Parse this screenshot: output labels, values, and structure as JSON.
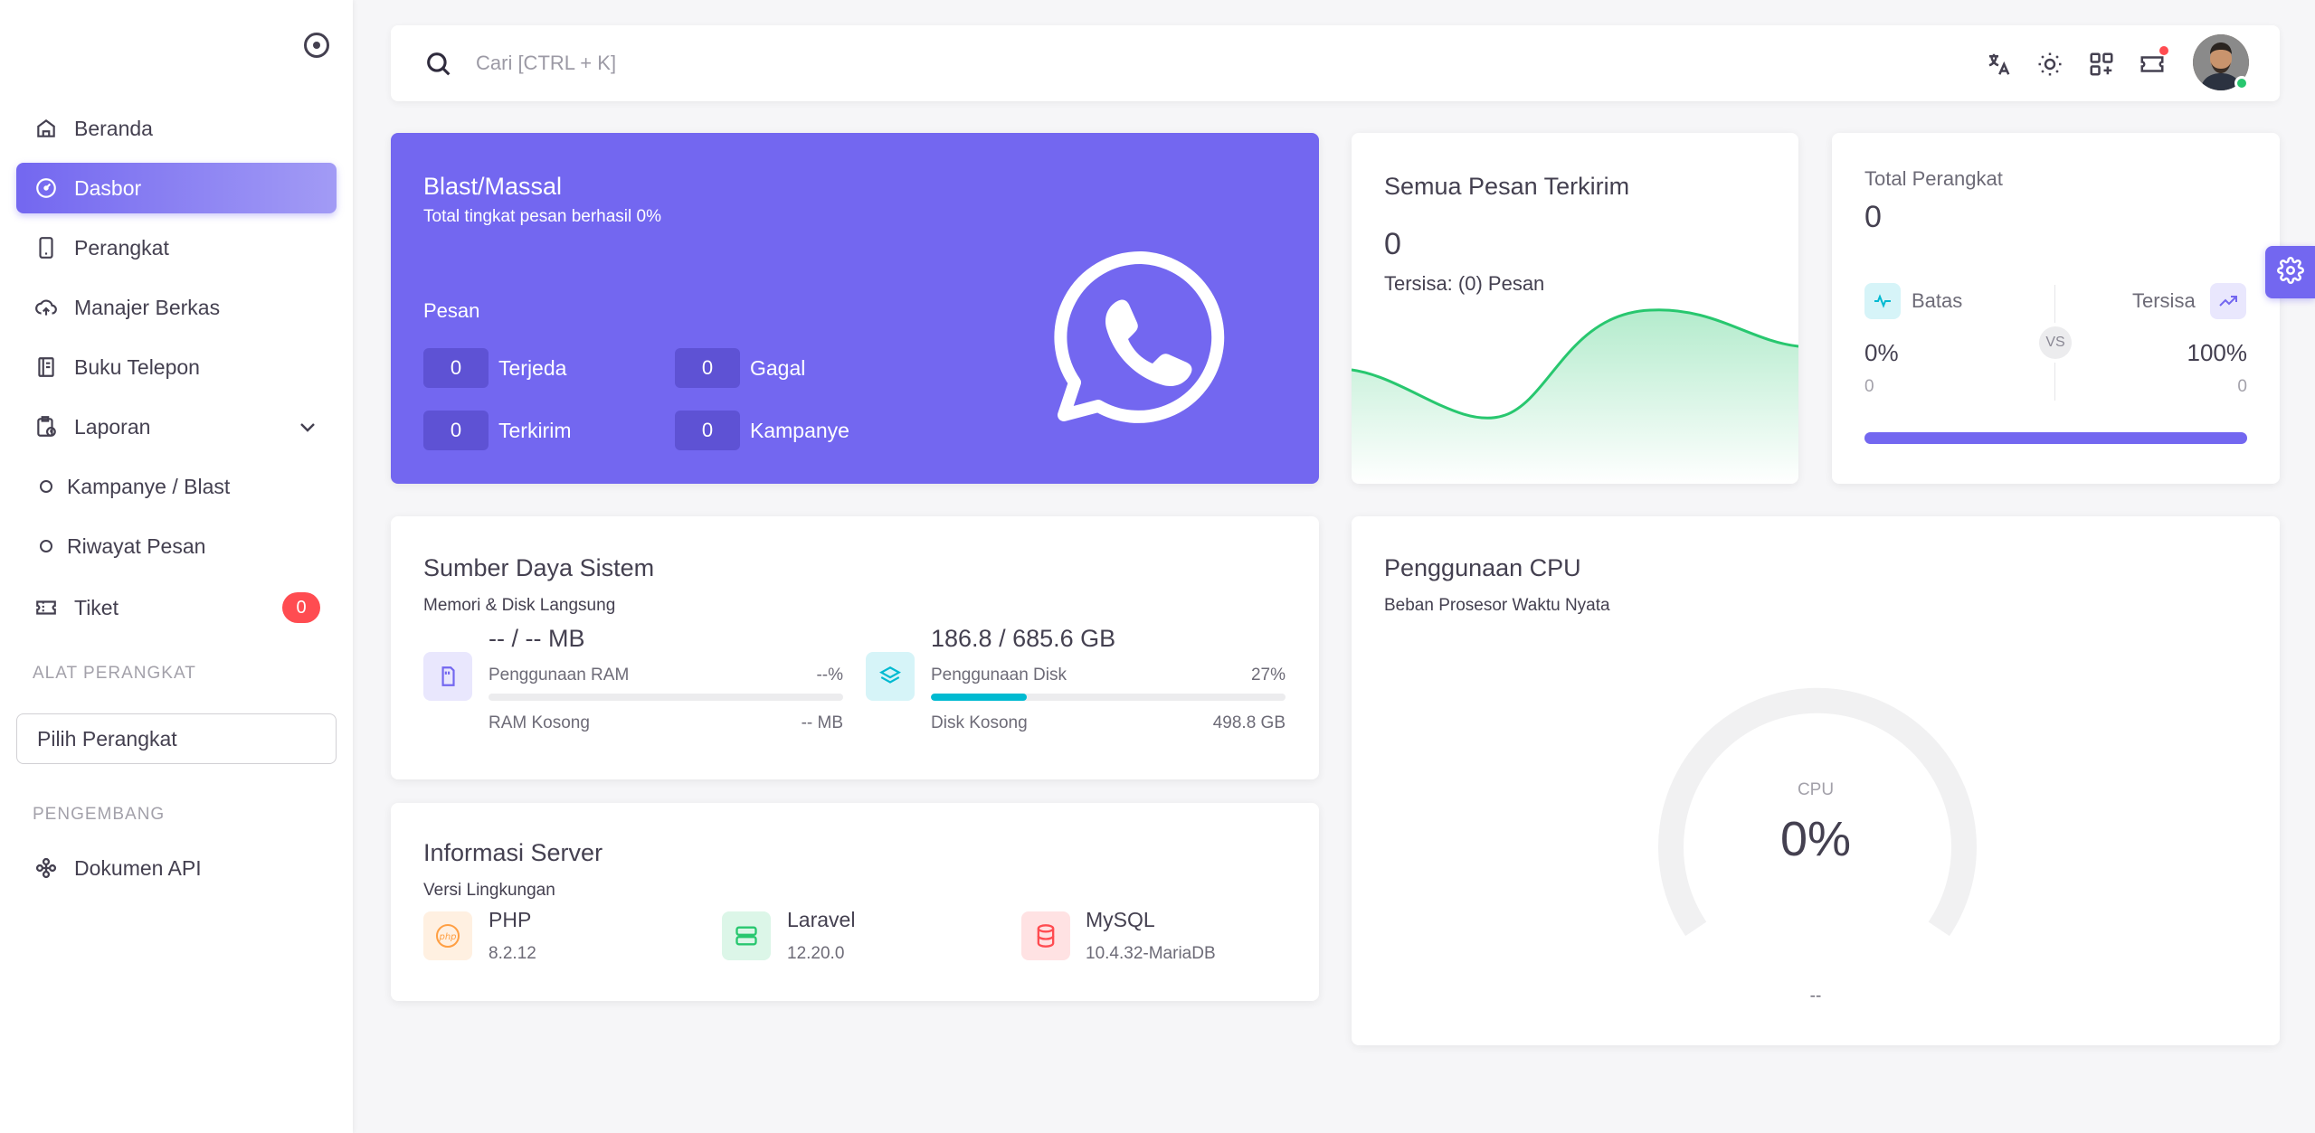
{
  "sidebar": {
    "items": [
      {
        "label": "Beranda",
        "icon": "home-icon"
      },
      {
        "label": "Dasbor",
        "icon": "dashboard-icon"
      },
      {
        "label": "Perangkat",
        "icon": "device-icon"
      },
      {
        "label": "Manajer Berkas",
        "icon": "cloud-upload-icon"
      },
      {
        "label": "Buku Telepon",
        "icon": "phonebook-icon"
      },
      {
        "label": "Laporan",
        "icon": "report-icon"
      },
      {
        "label": "Kampanye / Blast",
        "icon": "circle-icon"
      },
      {
        "label": "Riwayat Pesan",
        "icon": "circle-icon"
      },
      {
        "label": "Tiket",
        "icon": "ticket-icon",
        "badge": "0"
      }
    ],
    "section_tools": "ALAT PERANGKAT",
    "device_select": "Pilih Perangkat",
    "section_dev": "PENGEMBANG",
    "api_docs": "Dokumen API"
  },
  "topbar": {
    "search_placeholder": "Cari [CTRL + K]",
    "icons": [
      "translate-icon",
      "theme-sun-icon",
      "apps-grid-icon",
      "ticket-notification-icon"
    ]
  },
  "blast": {
    "title": "Blast/Massal",
    "subtitle": "Total tingkat pesan berhasil 0%",
    "section_label": "Pesan",
    "stats": [
      {
        "value": "0",
        "label": "Terjeda"
      },
      {
        "value": "0",
        "label": "Gagal"
      },
      {
        "value": "0",
        "label": "Terkirim"
      },
      {
        "value": "0",
        "label": "Kampanye"
      }
    ]
  },
  "sent": {
    "title": "Semua Pesan Terkirim",
    "value": "0",
    "remaining": "Tersisa: (0) Pesan"
  },
  "devices": {
    "title": "Total Perangkat",
    "value": "0",
    "limit_label": "Batas",
    "remaining_label": "Tersisa",
    "vs": "VS",
    "limit_pct": "0%",
    "limit_count": "0",
    "remaining_pct": "100%",
    "remaining_count": "0",
    "progress": 1.0
  },
  "resources": {
    "title": "Sumber Daya Sistem",
    "subtitle": "Memori & Disk Langsung",
    "ram": {
      "value": "-- / -- MB",
      "label": "Penggunaan RAM",
      "pct": "--%",
      "free_label": "RAM Kosong",
      "free_value": "-- MB",
      "progress": 0
    },
    "disk": {
      "value": "186.8 / 685.6 GB",
      "label": "Penggunaan Disk",
      "pct": "27%",
      "free_label": "Disk Kosong",
      "free_value": "498.8 GB",
      "progress": 0.27
    }
  },
  "server": {
    "title": "Informasi Server",
    "subtitle": "Versi Lingkungan",
    "items": [
      {
        "name": "PHP",
        "version": "8.2.12",
        "icon": "php-icon",
        "color": "#ff9f43"
      },
      {
        "name": "Laravel",
        "version": "12.20.0",
        "icon": "server-icon",
        "color": "#28c76f"
      },
      {
        "name": "MySQL",
        "version": "10.4.32-MariaDB",
        "icon": "database-icon",
        "color": "#ff4c51"
      }
    ]
  },
  "cpu": {
    "title": "Penggunaan CPU",
    "subtitle": "Beban Prosesor Waktu Nyata",
    "gauge_label": "CPU",
    "gauge_value": "0%",
    "footer": "--"
  },
  "colors": {
    "primary": "#7367f0",
    "success": "#28c76f",
    "danger": "#ff4c51",
    "info": "#00bad1"
  }
}
